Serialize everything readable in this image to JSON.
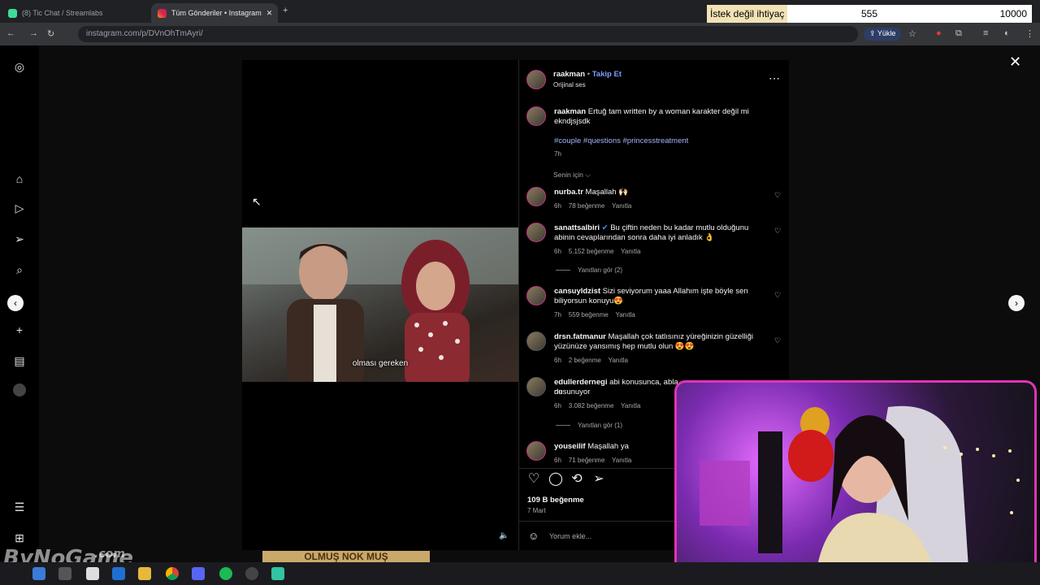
{
  "browser": {
    "tabs": [
      {
        "label": "(8) Tic Chat / Streamlabs"
      },
      {
        "label": "Tüm Gönderiler • Instagram"
      }
    ],
    "url": "instagram.com/p/DVnOhTmAyri/",
    "upload_label": "Yükle"
  },
  "overlay_counter": {
    "label": "İstek değil ihtiyaç",
    "current": "555",
    "goal": "10000"
  },
  "post": {
    "username": "raakman",
    "follow_label": "Takip Et",
    "audio": "Orijinal ses",
    "caption_text": "Ertuğ tam written by a woman karakter değil mi ekndjsjsdk",
    "hashtags": "#couple #questions #princesstreatment",
    "caption_time": "7h",
    "filter_label": "Senin için",
    "likes": "109 B beğenme",
    "date": "7 Mart",
    "comment_placeholder": "Yorum ekle...",
    "video_subtitle": "olması gereken"
  },
  "comments": [
    {
      "user": "nurba.tr",
      "text": "Maşallah 🙌🏻",
      "time": "6h",
      "likes": "78 beğenme",
      "reply": "Yanıtla"
    },
    {
      "user": "sanattsalbiri",
      "verified": "✔",
      "text": "Bu çiftin neden bu kadar mutlu olduğunu abinin cevaplarından sonra daha iyi anladık 👌",
      "time": "6h",
      "likes": "5.152 beğenme",
      "reply": "Yanıtla",
      "view_replies": "Yanıtları gör (2)"
    },
    {
      "user": "cansuyldzist",
      "text": "Sizi seviyorum yaaa Allahım işte böyle sen biliyorsun konuyu😍",
      "time": "7h",
      "likes": "559 beğenme",
      "reply": "Yanıtla"
    },
    {
      "user": "drsn.fatmanur",
      "text": "Maşallah çok tatlısınız yüreğinizin güzelliği yüzünüze yansımış hep mutlu olun 😍😍",
      "time": "6h",
      "likes": "2 beğenme",
      "reply": "Yanıtla"
    },
    {
      "user": "edullerdernegi",
      "text": "abi konusunca, abla ne",
      "text2": "dusunuyor",
      "time": "6h",
      "likes": "3.082 beğenme",
      "reply": "Yanıtla",
      "view_replies": "Yanıtları gör (1)"
    },
    {
      "user": "youseilif",
      "text": "Maşallah ya",
      "time": "6h",
      "likes": "71 beğenme",
      "reply": "Yanıtla"
    }
  ],
  "watermark": {
    "brand": "ByNoGame",
    "suffix": ".com"
  },
  "bottom_strip_text": "OLMUŞ NOK MUŞ",
  "icons": [
    "instagram-icon",
    "home-icon",
    "reels-icon",
    "send-icon",
    "search-icon",
    "plus-icon",
    "stats-icon",
    "profile-icon",
    "menu-icon",
    "more-icon",
    "heart-icon",
    "comment-icon",
    "repost-icon",
    "share-icon",
    "emoji-icon",
    "mute-icon",
    "close-icon",
    "chevron-left-icon",
    "chevron-right-icon"
  ],
  "colors": {
    "accent": "#a4b5ff",
    "story_ring": "#c13584",
    "webcam_border": "#e033b8"
  }
}
